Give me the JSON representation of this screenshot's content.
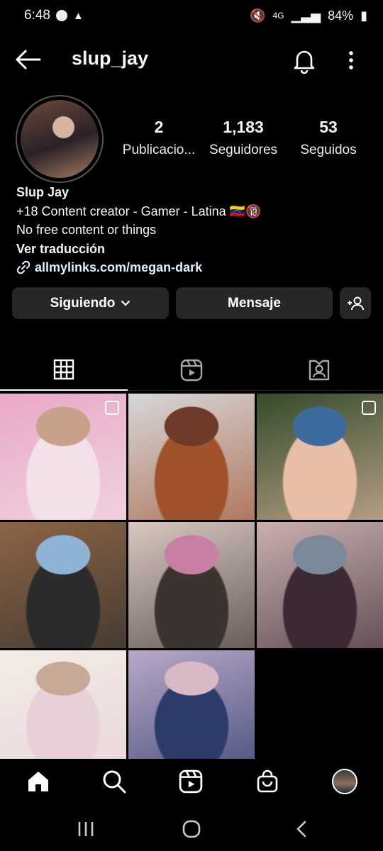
{
  "status": {
    "time": "6:48",
    "network": "4G",
    "battery": "84%"
  },
  "header": {
    "username": "slup_jay"
  },
  "profile": {
    "stats": [
      {
        "value": "2",
        "label": "Publicacio..."
      },
      {
        "value": "1,183",
        "label": "Seguidores"
      },
      {
        "value": "53",
        "label": "Seguidos"
      }
    ],
    "name": "Slup Jay",
    "bio_lines": [
      "+18 Content creator - Gamer - Latina 🇻🇪🔞",
      "No free content or things"
    ],
    "translate_label": "Ver traducción",
    "link": "allmylinks.com/megan-dark"
  },
  "actions": {
    "following_label": "Siguiendo",
    "message_label": "Mensaje"
  },
  "grid": {
    "posts": [
      {
        "colors": [
          "#e9a9c7",
          "#f3e1ea",
          "#c7a18a"
        ],
        "badge": "reel"
      },
      {
        "colors": [
          "#d7d7d9",
          "#a0522d",
          "#6e3a2a"
        ],
        "badge": ""
      },
      {
        "colors": [
          "#344a2c",
          "#e8bfa6",
          "#3e6b9e"
        ],
        "badge": "carousel"
      },
      {
        "colors": [
          "#8c6445",
          "#2b2b2b",
          "#8fb3d6"
        ],
        "badge": ""
      },
      {
        "colors": [
          "#d9c8c2",
          "#3a3330",
          "#c87fa6"
        ],
        "badge": ""
      },
      {
        "colors": [
          "#c9b0b0",
          "#3b2a33",
          "#7b8a9a"
        ],
        "badge": ""
      },
      {
        "colors": [
          "#f3ede6",
          "#e7d0d8",
          "#c8a896"
        ],
        "badge": ""
      },
      {
        "colors": [
          "#b9a9c8",
          "#2e3b6a",
          "#d9b9c6"
        ],
        "badge": ""
      }
    ]
  }
}
